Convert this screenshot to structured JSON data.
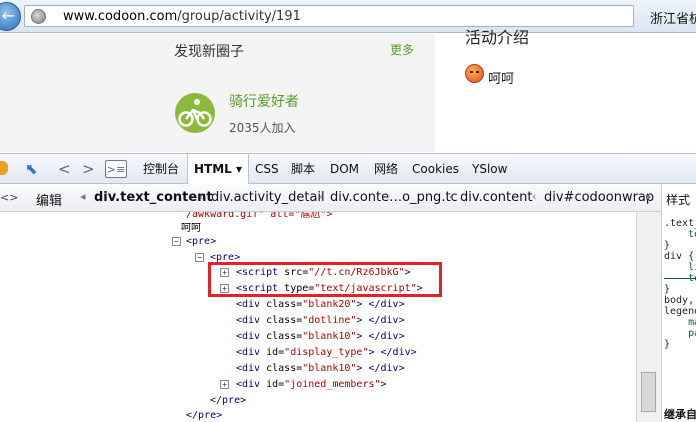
{
  "browser": {
    "back_glyph": "←",
    "url_host": "www.codoon.com",
    "url_path": "/group/activity/191",
    "region": "浙江省杭"
  },
  "page": {
    "discover_title": "发现新圈子",
    "more_label": "更多",
    "circle_name": "骑行爱好者",
    "circle_count": "2035人加入",
    "activity_heading": "活动介绍",
    "emoji_text": "呵呵"
  },
  "devtools": {
    "tabs": [
      "控制台",
      "HTML ▾",
      "CSS",
      "脚本",
      "DOM",
      "网络",
      "Cookies",
      "YSlow"
    ],
    "active_tab": "HTML ▾",
    "edit_label": "编辑",
    "breadcrumbs": [
      "div.text_content",
      "div.activity_detail",
      "div.conte…o_png.tc",
      "div.content",
      "div#codoonwrap"
    ],
    "style_tab": "样式",
    "style_footer": "继承自"
  },
  "tree": {
    "cut_line": "/awkward.gif\" alt=\"尴尬\">",
    "text_line": "呵呵",
    "pre_open": "<pre>",
    "pre_inner_open": "<pre>",
    "script1_tag": "<script ",
    "script1_attr": "src=",
    "script1_val": "\"//t.cn/Rz6JbkG\"",
    "script1_end": ">",
    "script2_tag": "<script ",
    "script2_attr": "type=",
    "script2_val": "\"text/javascript\"",
    "script2_end": ">",
    "divs": [
      {
        "attr": "class=",
        "val": "\"blank20\"",
        "end": "> </div>"
      },
      {
        "attr": "class=",
        "val": "\"dotline\"",
        "end": "> </div>"
      },
      {
        "attr": "class=",
        "val": "\"blank10\"",
        "end": "> </div>"
      },
      {
        "attr": "id=",
        "val": "\"display_type\"",
        "end": "> </div>"
      },
      {
        "attr": "class=",
        "val": "\"blank10\"",
        "end": "> </div>"
      }
    ],
    "joined_attr": "id=",
    "joined_val": "\"joined_members\"",
    "joined_end": ">",
    "pre_inner_close": "</pre>",
    "pre_close": "</pre>"
  },
  "style_panel_lines": [
    ".text_",
    "    te",
    "}",
    "div {",
    "    li",
    "    te",
    "}",
    "body,",
    "legend",
    "    ma",
    "    pa",
    "}"
  ]
}
